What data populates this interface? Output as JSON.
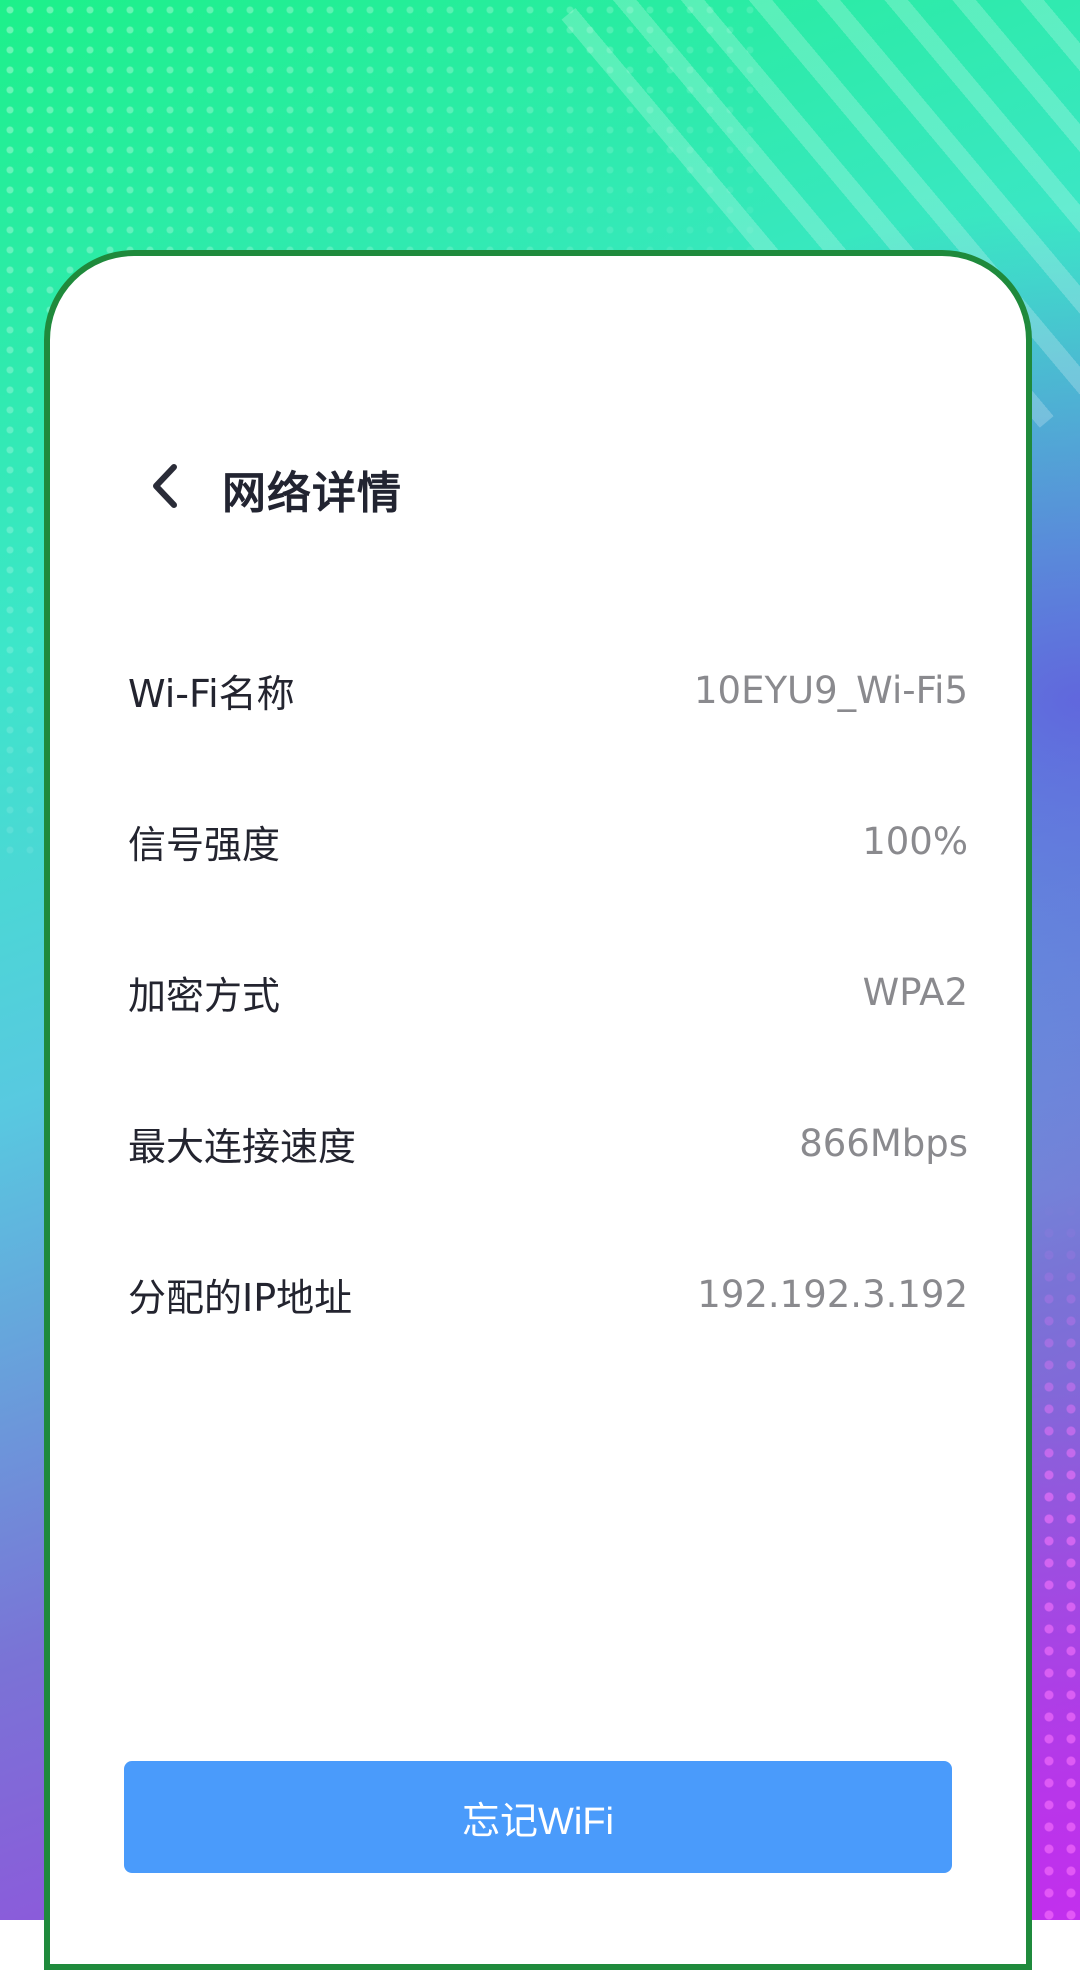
{
  "header": {
    "title": "网络详情",
    "back_icon": "chevron-left-icon"
  },
  "details": [
    {
      "label": "Wi-Fi名称",
      "value": "10EYU9_Wi-Fi5"
    },
    {
      "label": "信号强度",
      "value": "100%"
    },
    {
      "label": "加密方式",
      "value": "WPA2"
    },
    {
      "label": "最大连接速度",
      "value": "866Mbps"
    },
    {
      "label": "分配的IP地址",
      "value": "192.192.3.192"
    }
  ],
  "actions": {
    "forget_label": "忘记WiFi"
  },
  "colors": {
    "card_border": "#1f8a3c",
    "button": "#4a9bfb",
    "label_text": "#23242f",
    "value_text": "#8a8a8e"
  }
}
